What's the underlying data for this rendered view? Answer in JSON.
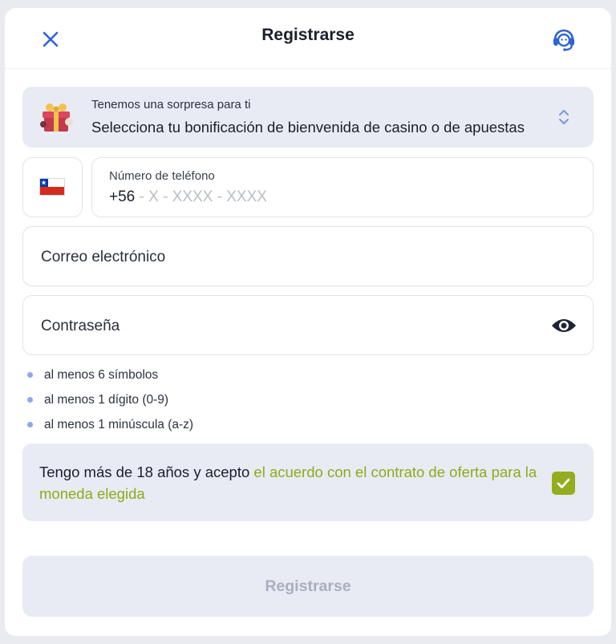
{
  "header": {
    "title": "Registrarse",
    "close_icon": "close-icon",
    "support_icon": "headset-support-icon"
  },
  "bonus": {
    "small_text": "Tenemos una sorpresa para ti",
    "main_text": "Selecciona tu bonificación de bienvenida de casino o de apuestas",
    "icon": "gift-icon",
    "chevron_icon": "chevron-up-down-icon"
  },
  "phone": {
    "country_flag": "chile-flag-icon",
    "label": "Número de teléfono",
    "prefix": "+56",
    "placeholder": " - X - XXXX - XXXX"
  },
  "email": {
    "placeholder": "Correo electrónico"
  },
  "password": {
    "placeholder": "Contraseña",
    "toggle_icon": "eye-icon"
  },
  "password_rules": [
    "al menos 6 símbolos",
    "al menos 1 dígito (0-9)",
    "al menos 1 minúscula (a-z)"
  ],
  "agreement": {
    "text": "Tengo más de 18 años y acepto ",
    "link_text": "el acuerdo con el contrato de oferta para la moneda elegida",
    "checked": true
  },
  "submit": {
    "label": "Registrarse",
    "disabled": true
  },
  "colors": {
    "accent_blue": "#2f62d6",
    "accent_green": "#93ad1f",
    "link_green": "#8cab1a",
    "panel_bg": "#e8ebf3"
  }
}
